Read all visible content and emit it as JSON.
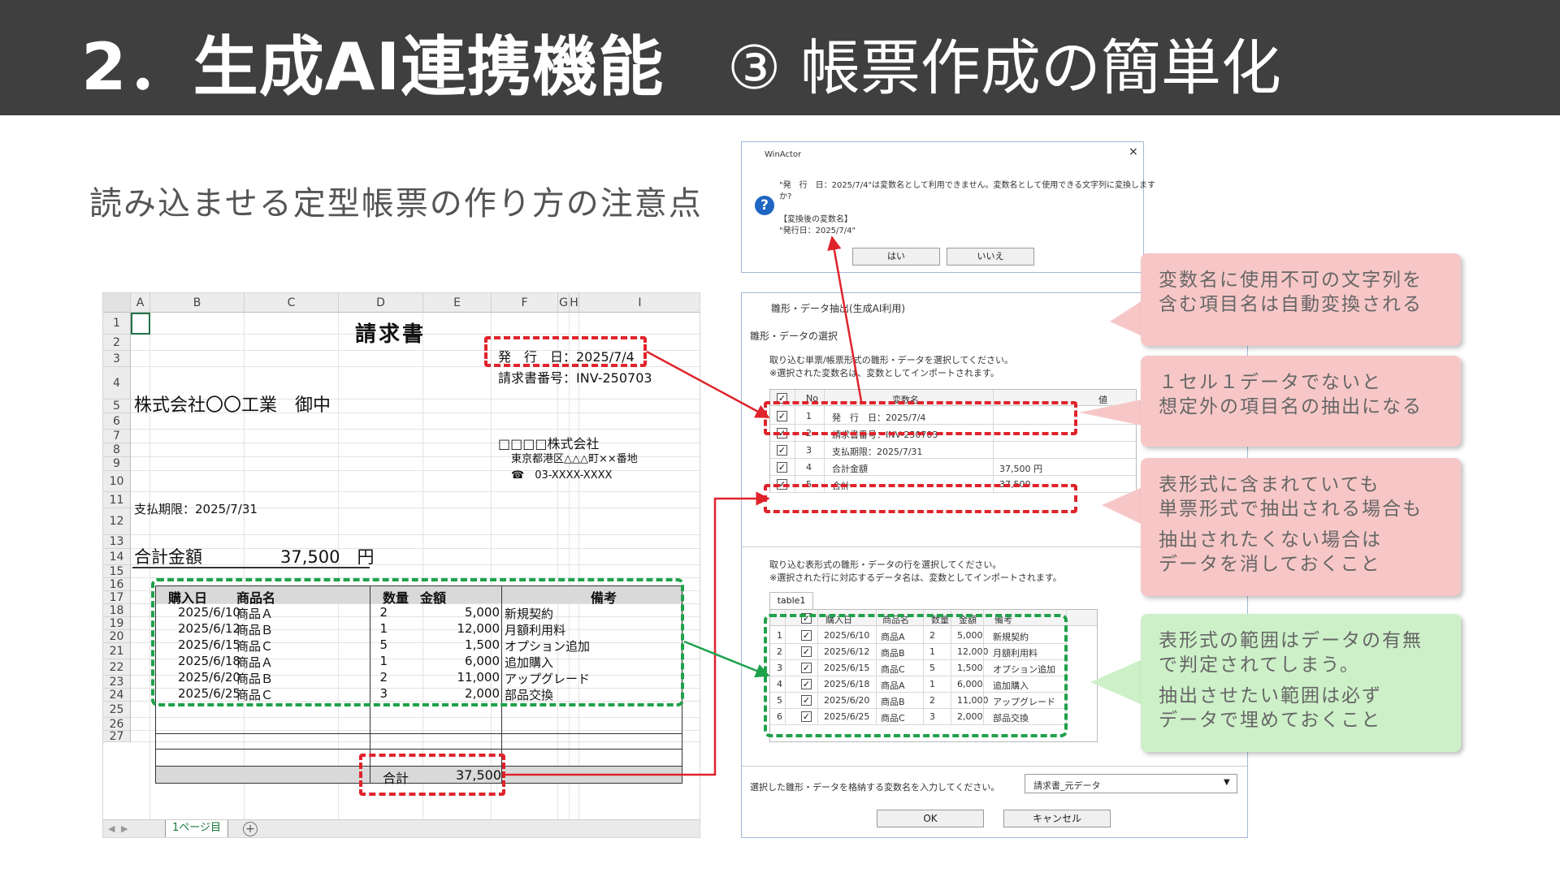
{
  "header": {
    "title_main": "2．生成AI連携機能",
    "title_sub": "③ 帳票作成の簡単化"
  },
  "subtitle": "読み込ませる定型帳票の作り方の注意点",
  "sheet": {
    "columns": [
      "A",
      "B",
      "C",
      "D",
      "E",
      "F",
      "G",
      "H",
      "I"
    ],
    "rows": [
      "1",
      "2",
      "3",
      "4",
      "5",
      "6",
      "7",
      "8",
      "9",
      "10",
      "11",
      "12",
      "13",
      "14",
      "15",
      "16",
      "17",
      "18",
      "19",
      "20",
      "21",
      "22",
      "23",
      "24",
      "25",
      "26",
      "27"
    ],
    "title": "請求書",
    "issue_date": "発　行　日：2025/7/4",
    "invoice_no": "請求書番号：INV-250703",
    "customer": "株式会社〇〇工業　御中",
    "company": "□□□□株式会社",
    "address": "東京都港区△△△町××番地",
    "phone": "☎　03-XXXX-XXXX",
    "due": "支払期限：2025/7/31",
    "total_label": "合計金額",
    "total_value": "37,500　円",
    "table_headers": [
      "購入日",
      "商品名",
      "数量",
      "金額",
      "備考"
    ],
    "table_rows": [
      [
        "2025/6/10",
        "商品Ａ",
        "2",
        "5,000",
        "新規契約"
      ],
      [
        "2025/6/12",
        "商品Ｂ",
        "1",
        "12,000",
        "月額利用料"
      ],
      [
        "2025/6/15",
        "商品Ｃ",
        "5",
        "1,500",
        "オプション追加"
      ],
      [
        "2025/6/18",
        "商品Ａ",
        "1",
        "6,000",
        "追加購入"
      ],
      [
        "2025/6/20",
        "商品Ｂ",
        "2",
        "11,000",
        "アップグレード"
      ],
      [
        "2025/6/25",
        "商品Ｃ",
        "3",
        "2,000",
        "部品交換"
      ]
    ],
    "sum_label": "合計",
    "sum_value": "37,500",
    "sheet_tab": "1ページ目"
  },
  "winactor_dialog": {
    "title": "WinActor",
    "close": "×",
    "line1": "\"発　行　日：2025/7/4\"は変数名として利用できません。変数名として使用できる文字列に変換します",
    "line2": "か?",
    "line3": "【変換後の変数名】",
    "line4": "\"発行日：2025/7/4\"",
    "yes": "はい",
    "no": "いいえ"
  },
  "extract_dialog": {
    "title": "雛形・データ抽出(生成AI利用)",
    "section": "雛形・データの選択",
    "desc1": "取り込む単票/帳票形式の雛形・データを選択してください。",
    "desc2": "※選択された変数名は、変数としてインポートされます。",
    "var_headers": [
      "No",
      "変数名",
      "値"
    ],
    "var_rows": [
      [
        "1",
        "発　行　日：2025/7/4",
        ""
      ],
      [
        "2",
        "請求書番号：INV-250703",
        ""
      ],
      [
        "3",
        "支払期限：2025/7/31",
        ""
      ],
      [
        "4",
        "合計金額",
        "37,500 円"
      ],
      [
        "5",
        "合計",
        "37,500"
      ]
    ],
    "desc3": "取り込む表形式の雛形・データの行を選択してください。",
    "desc4": "※選択された行に対応するデータ名は、変数としてインポートされます。",
    "tab": "table1",
    "table_headers": [
      "",
      "購入日",
      "商品名",
      "数量",
      "金額",
      "備考"
    ],
    "table_rows": [
      [
        "1",
        "2025/6/10",
        "商品A",
        "2",
        "5,000",
        "新規契約"
      ],
      [
        "2",
        "2025/6/12",
        "商品B",
        "1",
        "12,000",
        "月額利用料"
      ],
      [
        "3",
        "2025/6/15",
        "商品C",
        "5",
        "1,500",
        "オプション追加"
      ],
      [
        "4",
        "2025/6/18",
        "商品A",
        "1",
        "6,000",
        "追加購入"
      ],
      [
        "5",
        "2025/6/20",
        "商品B",
        "2",
        "11,000",
        "アップグレード"
      ],
      [
        "6",
        "2025/6/25",
        "商品C",
        "3",
        "2,000",
        "部品交換"
      ]
    ],
    "store_label": "選択した雛形・データを格納する変数名を入力してください。",
    "store_value": "請求書_元データ",
    "ok": "OK",
    "cancel": "キャンセル"
  },
  "callouts": [
    {
      "text": "変数名に使用不可の文字列を\n含む項目名は自動変換される",
      "color": "#f7c7c7"
    },
    {
      "text": "１セル１データでないと\n想定外の項目名の抽出になる",
      "color": "#f7c7c7"
    },
    {
      "text": "表形式に含まれていても\n単票形式で抽出される場合も",
      "extra": "抽出されたくない場合は\nデータを消しておくこと",
      "color": "#f7c7c7"
    },
    {
      "text": "表形式の範囲はデータの有無\nで判定されてしまう。",
      "extra": "抽出させたい範囲は必ず\nデータで埋めておくこと",
      "color": "#cdf0c8"
    }
  ],
  "colors": {
    "header_bg": "#3f3f3f",
    "red_marker": "#e0232b",
    "green_marker": "#1ea24a"
  }
}
